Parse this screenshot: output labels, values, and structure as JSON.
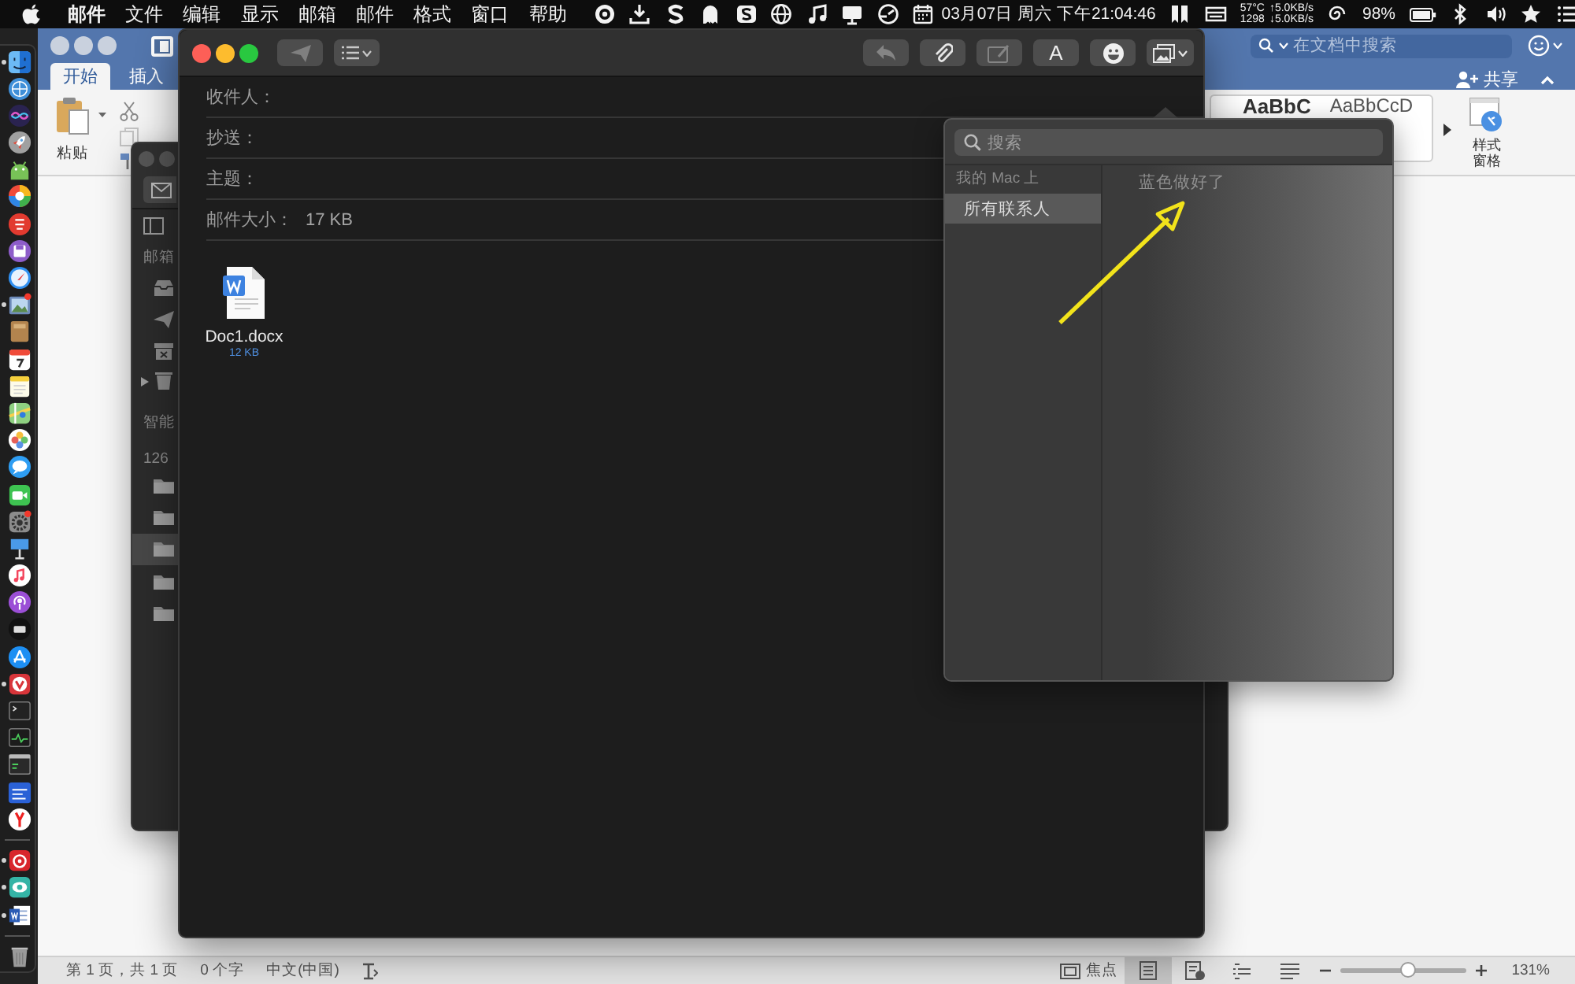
{
  "menu_bar": {
    "app_name": "邮件",
    "menus": [
      "文件",
      "编辑",
      "显示",
      "邮箱",
      "邮件",
      "格式",
      "窗口",
      "帮助"
    ],
    "date_time": "03月07日 周六 下午21:04:46",
    "sensors": {
      "temperature": "57°C",
      "upload": "↑5.0KB/s",
      "fan_speed": "1298",
      "download": "↓5.0KB/s"
    },
    "battery": "98%"
  },
  "dock": {
    "sections": [
      {
        "apps": [
          {
            "kind": "finder",
            "running": true
          },
          {
            "kind": "network",
            "running": false
          },
          {
            "kind": "siri",
            "running": false
          },
          {
            "kind": "launchpad",
            "running": false
          },
          {
            "kind": "android",
            "running": false
          },
          {
            "kind": "pinwheel",
            "running": false
          },
          {
            "kind": "redapp",
            "running": false
          },
          {
            "kind": "disk",
            "running": false
          },
          {
            "kind": "safari",
            "running": false
          },
          {
            "kind": "preview",
            "running": true
          },
          {
            "kind": "notebook",
            "running": false
          },
          {
            "kind": "calendar",
            "running": false
          },
          {
            "kind": "notes",
            "running": false
          },
          {
            "kind": "maps",
            "running": false
          },
          {
            "kind": "photos",
            "running": false
          },
          {
            "kind": "messages",
            "running": false
          },
          {
            "kind": "facetime",
            "running": false
          },
          {
            "kind": "settings",
            "running": false
          },
          {
            "kind": "keynote",
            "running": false
          },
          {
            "kind": "music",
            "running": false
          },
          {
            "kind": "podcasts",
            "running": false
          },
          {
            "kind": "tv",
            "running": false
          },
          {
            "kind": "appstore",
            "running": false
          },
          {
            "kind": "vivaldi",
            "running": true
          },
          {
            "kind": "terminal",
            "running": false
          },
          {
            "kind": "activity",
            "running": false
          },
          {
            "kind": "console",
            "running": false
          },
          {
            "kind": "vpn",
            "running": false
          },
          {
            "kind": "yandex",
            "running": false
          }
        ]
      },
      {
        "apps": [
          {
            "kind": "netease",
            "running": true
          },
          {
            "kind": "viewer",
            "running": true
          },
          {
            "kind": "word",
            "running": true
          }
        ]
      },
      {
        "apps": [
          {
            "kind": "trash",
            "running": false
          }
        ]
      }
    ]
  },
  "word_window": {
    "tabs": [
      {
        "label": "开始",
        "selected": true
      },
      {
        "label": "插入",
        "selected": false
      }
    ],
    "search": {
      "placeholder": "在文档中搜索"
    },
    "share_button": "共享",
    "paste_button": "粘贴",
    "styles": [
      "AaBbC",
      "AaBbCcD"
    ],
    "styles_pane_button": "样式窗格",
    "status_bar": {
      "page": "第 1 页，共 1 页",
      "words": "0 个字",
      "language": "中文(中国)",
      "focus": "焦点",
      "views": [
        {
          "kind": "print",
          "selected": true
        },
        {
          "kind": "web",
          "selected": false
        },
        {
          "kind": "outline",
          "selected": false
        },
        {
          "kind": "draft",
          "selected": false
        }
      ],
      "zoom": {
        "level": 0.54,
        "reading": "131%"
      }
    }
  },
  "mail_window": {
    "sidebar": {
      "mailboxes_heading": "邮箱",
      "smart_heading": "智能",
      "account": "126",
      "folders": [
        {
          "selected": false
        },
        {
          "selected": false
        },
        {
          "selected": true
        },
        {
          "selected": false
        },
        {
          "selected": false
        }
      ]
    }
  },
  "compose_window": {
    "toolbar_left": [
      {
        "kind": "send",
        "disabled": true
      },
      {
        "kind": "list",
        "disabled": false
      }
    ],
    "toolbar_right": [
      {
        "kind": "reply",
        "disabled": true
      },
      {
        "kind": "attach",
        "disabled": false
      },
      {
        "kind": "markup",
        "disabled": true
      },
      {
        "kind": "font",
        "label": "A",
        "disabled": false
      },
      {
        "kind": "emoji",
        "disabled": false
      },
      {
        "kind": "photo",
        "disabled": false
      }
    ],
    "fields": [
      {
        "label": "收件人："
      },
      {
        "label": "抄送："
      },
      {
        "label": "主题："
      },
      {
        "label": "邮件大小：",
        "value": "17 KB"
      }
    ],
    "attachment": {
      "name": "Doc1.docx",
      "size": "12 KB"
    }
  },
  "contacts_popover": {
    "search": {
      "placeholder": "搜索"
    },
    "section": "我的 Mac 上",
    "groups": [
      {
        "label": "所有联系人",
        "selected": true
      }
    ],
    "message": "蓝色做好了"
  }
}
